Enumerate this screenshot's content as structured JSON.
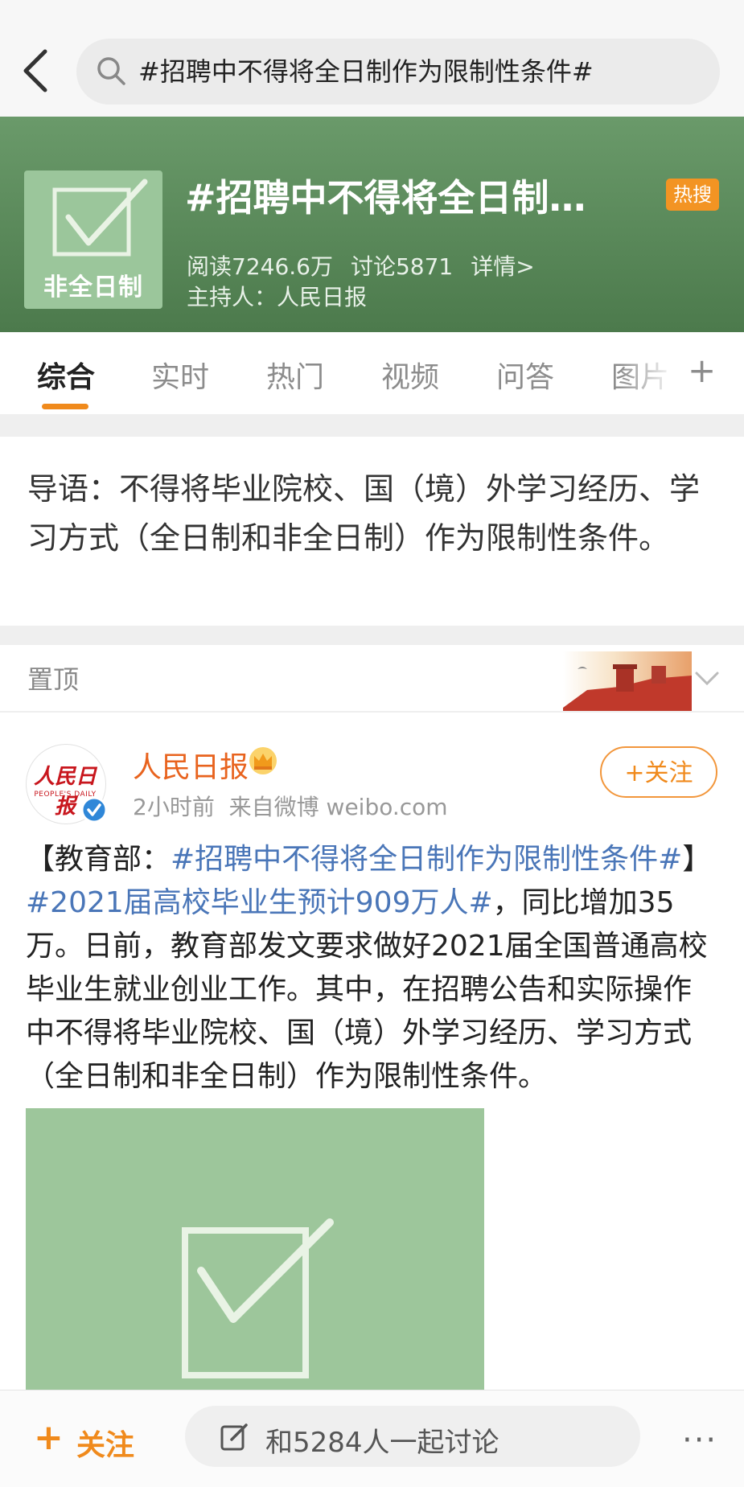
{
  "search": {
    "query": "#招聘中不得将全日制作为限制性条件#"
  },
  "header": {
    "logo_text": "非全日制",
    "title": "#招聘中不得将全日制…",
    "badge": "热搜",
    "reads": "阅读7246.6万",
    "discussions": "讨论5871",
    "details": "详情>",
    "host": "主持人：人民日报"
  },
  "tabs": [
    {
      "label": "综合"
    },
    {
      "label": "实时"
    },
    {
      "label": "热门"
    },
    {
      "label": "视频"
    },
    {
      "label": "问答"
    },
    {
      "label": "图片"
    }
  ],
  "intro": "导语：不得将毕业院校、国（境）外学习经历、学习方式（全日制和非全日制）作为限制性条件。",
  "pinned": {
    "label": "置顶"
  },
  "post": {
    "avatar_text": "人民日报",
    "avatar_sub": "PEOPLE'S DAILY",
    "author": "人民日报",
    "time": "2小时前",
    "source": "来自微博 weibo.com",
    "follow_label": "+关注",
    "body_prefix": "【教育部：",
    "body_link1": "#招聘中不得将全日制作为限制性条件#",
    "body_bracket": "】",
    "body_link2": "#2021届高校毕业生预计909万人#",
    "body_rest": "，同比增加35万。日前，教育部发文要求做好2021届全国普通高校毕业生就业创业工作。其中，在招聘公告和实际操作中不得将毕业院校、国（境）外学习经历、学习方式（全日制和非全日制）作为限制性条件。"
  },
  "bottom": {
    "follow_plus": "+",
    "follow": "关注",
    "discuss": "和5284人一起讨论",
    "more": "···"
  },
  "colors": {
    "accent": "#f08a1c",
    "link": "#4a76b8",
    "header_green": "#5d8d5d",
    "image_green": "#9dc69b",
    "hot_badge": "#f39423"
  }
}
